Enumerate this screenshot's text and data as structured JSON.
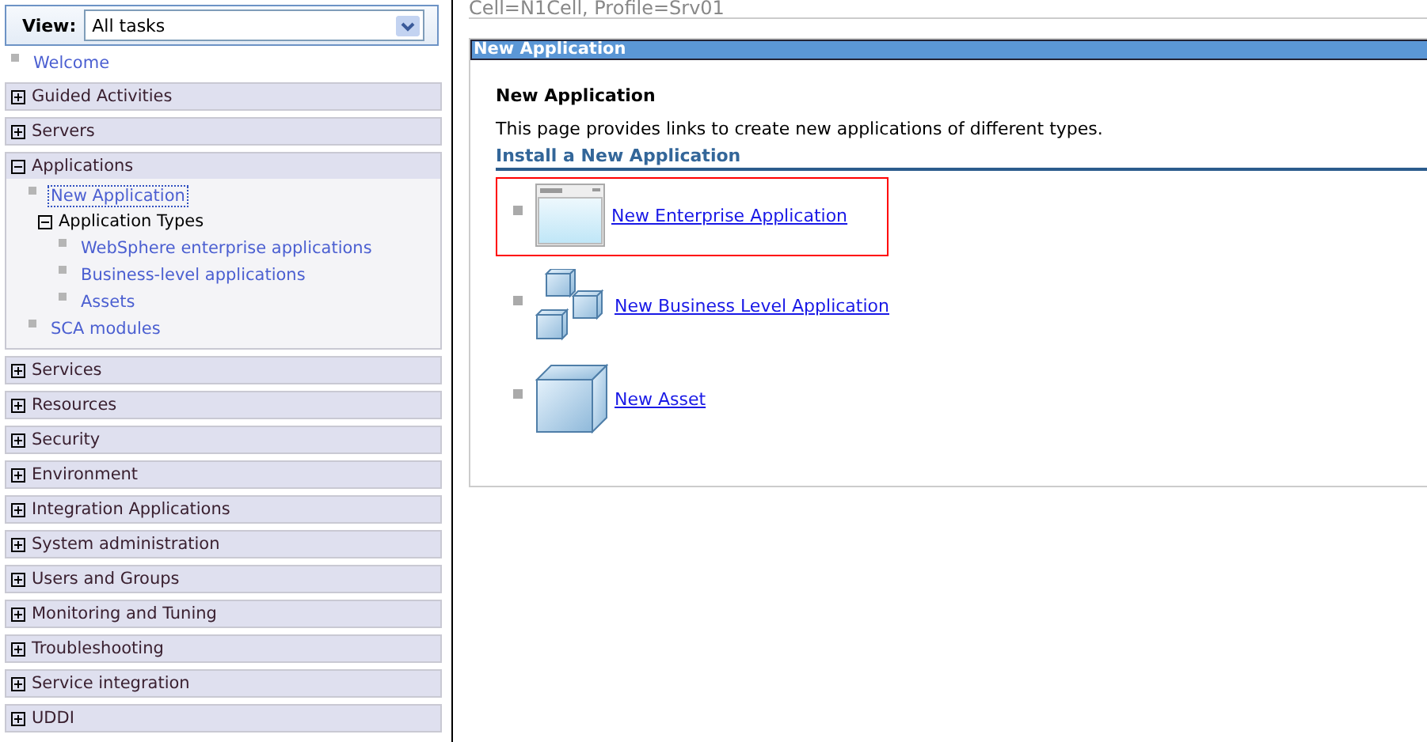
{
  "view": {
    "label": "View:",
    "value": "All tasks"
  },
  "nav": [
    {
      "kind": "link",
      "label": "Welcome",
      "selected": false
    },
    {
      "kind": "section",
      "label": "Guided Activities",
      "expanded": false
    },
    {
      "kind": "section",
      "label": "Servers",
      "expanded": false
    },
    {
      "kind": "section",
      "label": "Applications",
      "expanded": true,
      "children": [
        {
          "kind": "link",
          "label": "New Application",
          "selected": true
        },
        {
          "kind": "group",
          "label": "Application Types",
          "expanded": true,
          "children": [
            {
              "kind": "link",
              "label": "WebSphere enterprise applications",
              "selected": false
            },
            {
              "kind": "link",
              "label": "Business-level applications",
              "selected": false
            },
            {
              "kind": "link",
              "label": "Assets",
              "selected": false
            }
          ]
        },
        {
          "kind": "link",
          "label": "SCA modules",
          "selected": false
        }
      ]
    },
    {
      "kind": "section",
      "label": "Services",
      "expanded": false
    },
    {
      "kind": "section",
      "label": "Resources",
      "expanded": false
    },
    {
      "kind": "section",
      "label": "Security",
      "expanded": false
    },
    {
      "kind": "section",
      "label": "Environment",
      "expanded": false
    },
    {
      "kind": "section",
      "label": "Integration Applications",
      "expanded": false
    },
    {
      "kind": "section",
      "label": "System administration",
      "expanded": false
    },
    {
      "kind": "section",
      "label": "Users and Groups",
      "expanded": false
    },
    {
      "kind": "section",
      "label": "Monitoring and Tuning",
      "expanded": false
    },
    {
      "kind": "section",
      "label": "Troubleshooting",
      "expanded": false
    },
    {
      "kind": "section",
      "label": "Service integration",
      "expanded": false
    },
    {
      "kind": "section",
      "label": "UDDI",
      "expanded": false
    }
  ],
  "breadcrumb": "Cell=N1Cell, Profile=Srv01",
  "panel": {
    "title": "New Application",
    "heading": "New Application",
    "description": "This page provides links to create new applications of different types.",
    "section_title": "Install a New Application",
    "links": [
      {
        "kind": "window",
        "label": "New Enterprise Application",
        "highlighted": true
      },
      {
        "kind": "blocks",
        "label": "New Business Level Application",
        "highlighted": false
      },
      {
        "kind": "cube",
        "label": "New Asset",
        "highlighted": false
      }
    ]
  }
}
